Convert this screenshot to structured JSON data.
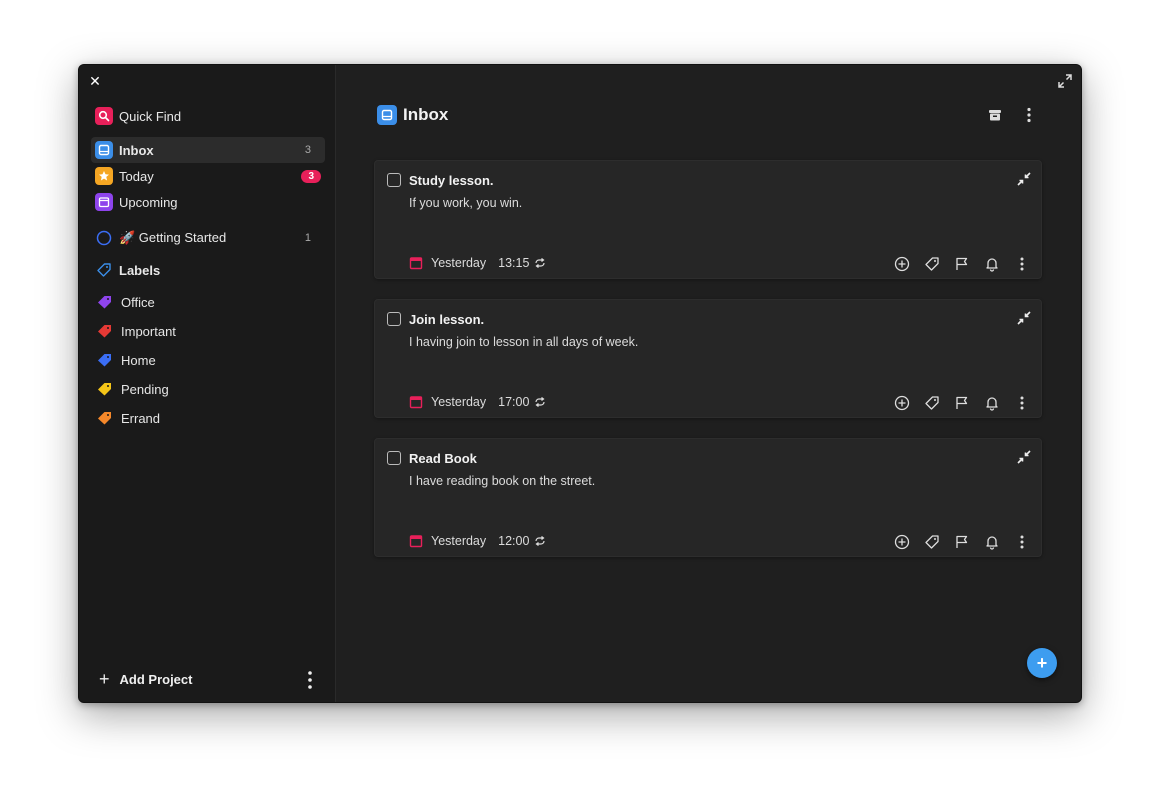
{
  "window": {
    "close_glyph": "✕"
  },
  "sidebar": {
    "quick_find": {
      "label": "Quick Find",
      "icon": "search-icon",
      "color": "#e8205a"
    },
    "nav": [
      {
        "label": "Inbox",
        "count": "3",
        "icon": "inbox-icon",
        "color": "#3b8ee8",
        "active": true
      },
      {
        "label": "Today",
        "count": "3",
        "icon": "star-icon",
        "color": "#f5a623",
        "badge": true
      },
      {
        "label": "Upcoming",
        "icon": "calendar-icon",
        "color": "#8e44ec"
      }
    ],
    "project": {
      "label": "🚀 Getting Started",
      "count": "1",
      "icon": "circle-icon",
      "color": "#3b6ef5"
    },
    "labels_header": "Labels",
    "labels": [
      {
        "label": "Office",
        "color": "#8e44ec",
        "icon": "tag-icon"
      },
      {
        "label": "Important",
        "color": "#e53935",
        "icon": "tag-icon"
      },
      {
        "label": "Home",
        "color": "#3b6ef5",
        "icon": "tag-icon"
      },
      {
        "label": "Pending",
        "color": "#f5c518",
        "icon": "tag-icon"
      },
      {
        "label": "Errand",
        "color": "#f5882a",
        "icon": "tag-icon"
      }
    ],
    "footer": {
      "add_project": "Add Project",
      "plus": "+"
    }
  },
  "main": {
    "title": "Inbox",
    "tasks": [
      {
        "title": "Study lesson.",
        "description": "If you work, you win.",
        "date": "Yesterday",
        "time": "13:15"
      },
      {
        "title": "Join lesson.",
        "description": "I having join to lesson in all days of week.",
        "date": "Yesterday",
        "time": "17:00"
      },
      {
        "title": "Read Book",
        "description": "I have reading book on the street.",
        "date": "Yesterday",
        "time": "12:00"
      }
    ],
    "fab": "+"
  },
  "colors": {
    "accent": "#3d9df0",
    "danger": "#e8205a",
    "background": "#1f1f1f",
    "sidebar": "#1a1a1a",
    "card": "#262626"
  }
}
